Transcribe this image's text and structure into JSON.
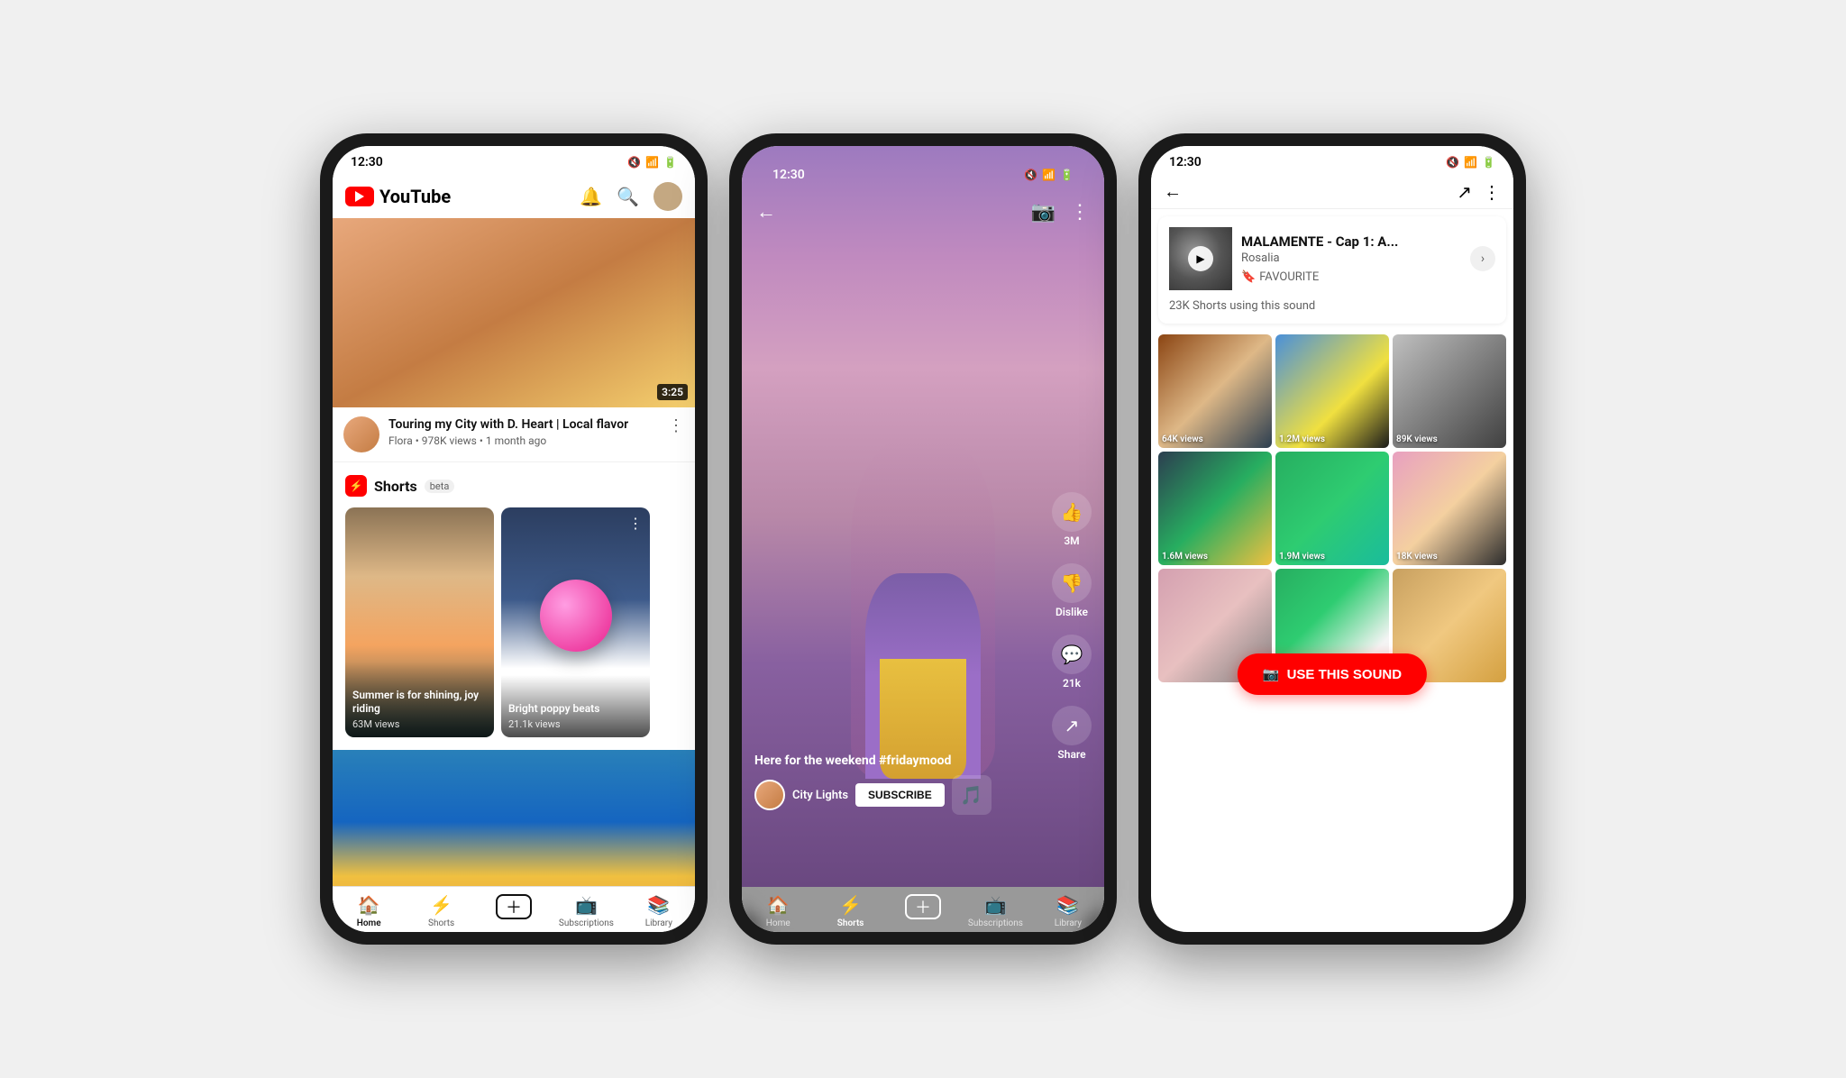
{
  "phone1": {
    "status": {
      "time": "12:30",
      "icons": "🔇 📶 🔋"
    },
    "header": {
      "logo_text": "YouTube",
      "bell_label": "🔔",
      "search_label": "🔍"
    },
    "video": {
      "duration": "3:25",
      "title": "Touring my City with D. Heart | Local flavor",
      "channel": "Flora",
      "views": "978K views",
      "time_ago": "1 month ago"
    },
    "shorts": {
      "label": "Shorts",
      "beta": "beta",
      "cards": [
        {
          "title": "Summer is for shining, joy riding",
          "views": "63M views",
          "bg_class": "short-card-1"
        },
        {
          "title": "Bright poppy beats",
          "views": "21.1k views",
          "bg_class": "short-card-2"
        }
      ]
    },
    "nav": {
      "items": [
        {
          "icon": "🏠",
          "label": "Home",
          "active": true
        },
        {
          "icon": "⚡",
          "label": "Shorts",
          "active": false
        },
        {
          "icon": "+",
          "label": "",
          "active": false,
          "is_add": true
        },
        {
          "icon": "📺",
          "label": "Subscriptions",
          "active": false
        },
        {
          "icon": "📚",
          "label": "Library",
          "active": false
        }
      ]
    }
  },
  "phone2": {
    "status": {
      "time": "12:30",
      "icons": "🔇 📶 🔋"
    },
    "caption": "Here for the weekend ",
    "hashtag": "#fridaymood",
    "channel_name": "City Lights",
    "subscribe_label": "SUBSCRIBE",
    "actions": [
      {
        "icon": "👍",
        "count": "3M"
      },
      {
        "icon": "👎",
        "count": "Dislike"
      },
      {
        "icon": "💬",
        "count": "21k"
      },
      {
        "icon": "↗",
        "count": "Share"
      }
    ],
    "nav": {
      "items": [
        {
          "icon": "🏠",
          "label": "Home"
        },
        {
          "icon": "⚡",
          "label": "Shorts"
        },
        {
          "icon": "+",
          "label": "",
          "is_add": true
        },
        {
          "icon": "📺",
          "label": "Subscriptions"
        },
        {
          "icon": "📚",
          "label": "Library"
        }
      ]
    }
  },
  "phone3": {
    "status": {
      "time": "12:30",
      "icons": "🔇 📶 🔋"
    },
    "sound": {
      "title": "MALAMENTE - Cap 1: A...",
      "artist": "Rosalia",
      "fav_label": "FAVOURITE",
      "count_text": "23K Shorts using this sound"
    },
    "grid": [
      {
        "label": "64K views",
        "bg": "gt1"
      },
      {
        "label": "1.2M views",
        "bg": "gt2"
      },
      {
        "label": "89K views",
        "bg": "gt3"
      },
      {
        "label": "1.6M views",
        "bg": "gt4"
      },
      {
        "label": "1.9M views",
        "bg": "gt5"
      },
      {
        "label": "18K views",
        "bg": "gt6"
      },
      {
        "label": "",
        "bg": "gt7"
      },
      {
        "label": "",
        "bg": "gt8"
      },
      {
        "label": "",
        "bg": "gt9"
      }
    ],
    "use_sound_label": "USE THIS SOUND"
  }
}
